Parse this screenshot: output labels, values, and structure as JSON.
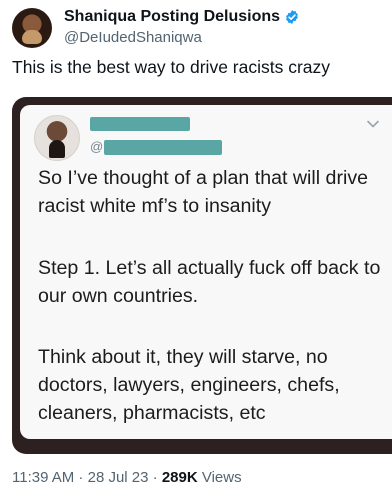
{
  "author": {
    "display_name": "Shaniqua Posting Delusions",
    "handle": "@DeIudedShaniqwa"
  },
  "tweet": {
    "text": "This is the best way to drive racists crazy"
  },
  "embedded_post": {
    "handle_prefix": "@",
    "paragraphs": [
      "So I’ve thought of a plan that will drive racist white mf’s to insanity",
      "Step 1. Let’s all actually fuck off back to our own countries.",
      "Think about it, they will starve, no doctors, lawyers, engineers, chefs, cleaners, pharmacists, etc"
    ]
  },
  "meta": {
    "time": "11:39 AM",
    "separator": " · ",
    "date": "28 Jul 23",
    "views_count": "289K",
    "views_label": " Views"
  },
  "colors": {
    "verified": "#1d9bf0",
    "redaction": "#5aa6a4",
    "embed_frame": "#2c2020"
  }
}
